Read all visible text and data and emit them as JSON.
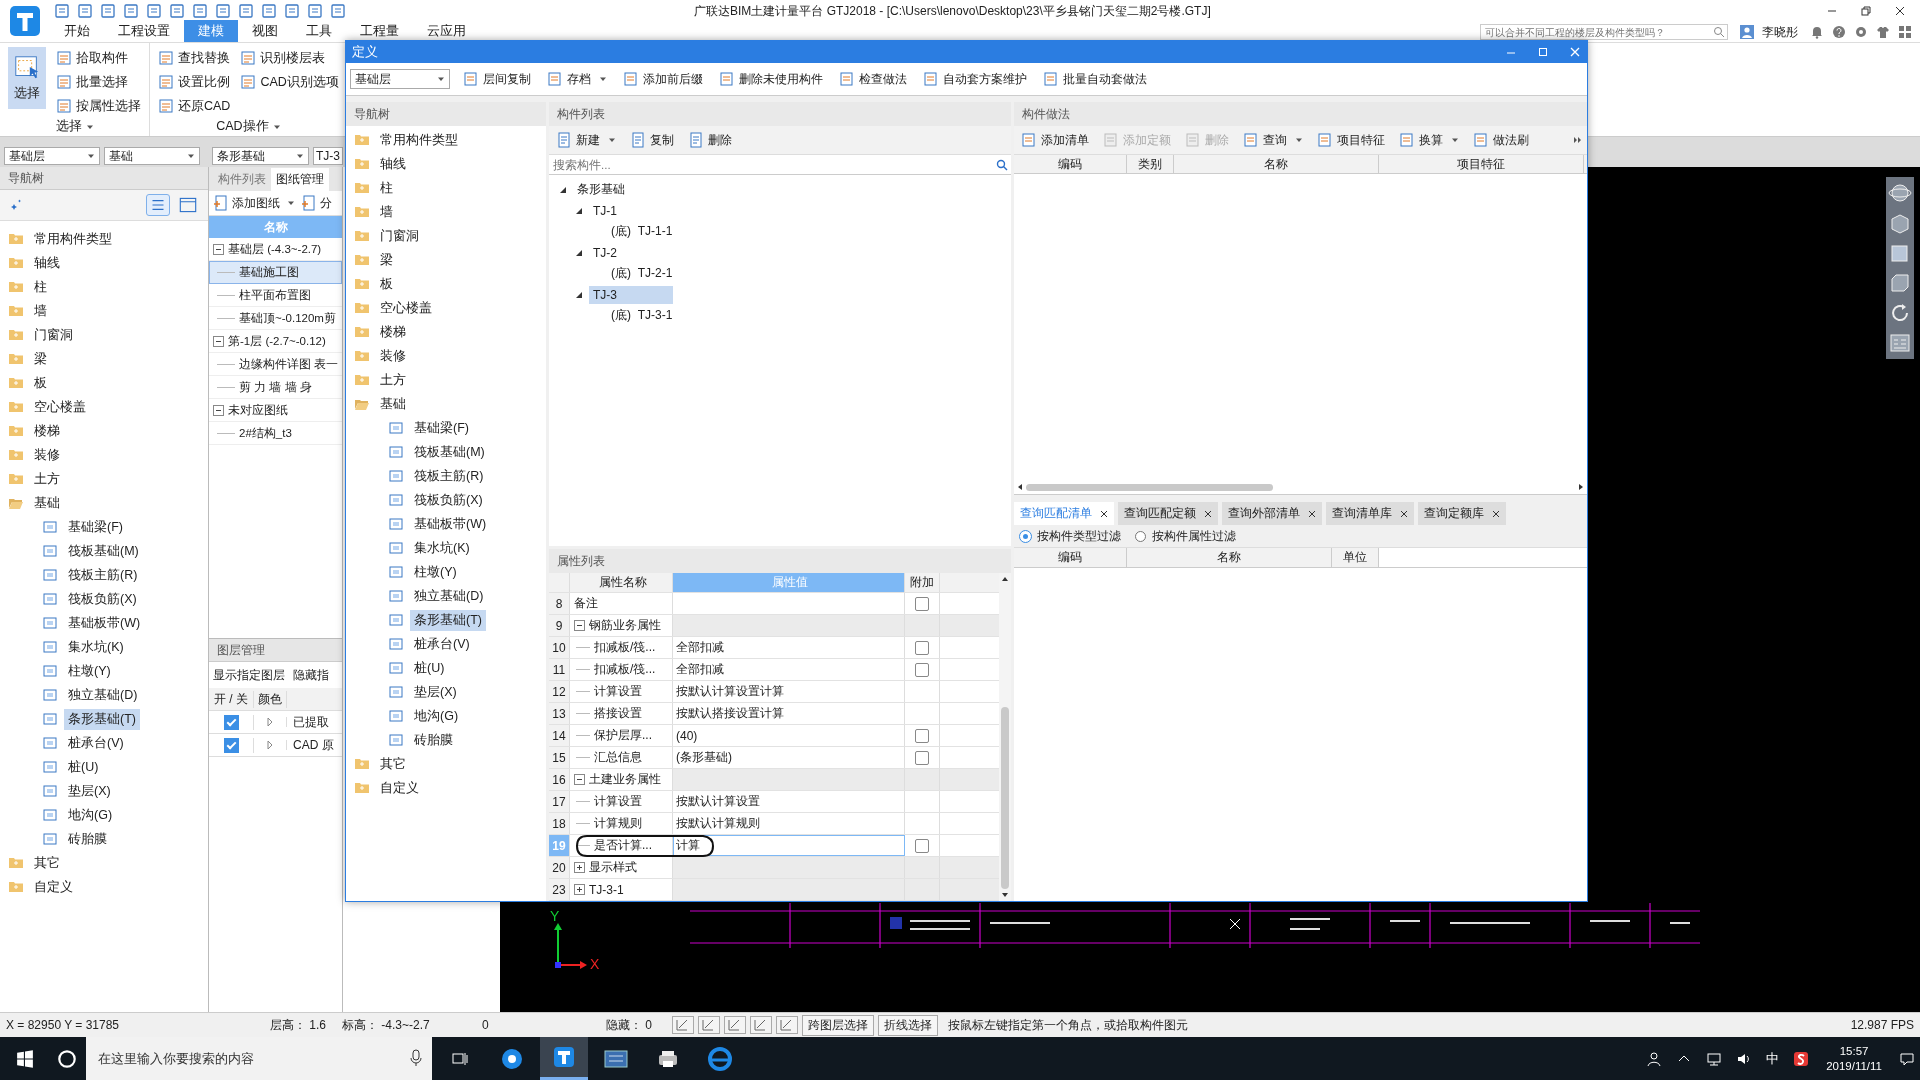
{
  "app": {
    "title": "广联达BIM土建计量平台 GTJ2018 - [C:\\Users\\lenovo\\Desktop\\23\\平乡县铭门天玺二期2号楼.GTJ]",
    "ribbon_tabs": [
      {
        "label": "开始",
        "selected": false
      },
      {
        "label": "工程设置",
        "selected": false
      },
      {
        "label": "建模",
        "selected": true
      },
      {
        "label": "视图",
        "selected": false
      },
      {
        "label": "工具",
        "selected": false
      },
      {
        "label": "工程量",
        "selected": false
      },
      {
        "label": "云应用",
        "selected": false
      }
    ],
    "help_search": {
      "placeholder": "可以合并不同工程的楼层及构件类型吗？"
    },
    "user": "李晓彤"
  },
  "ribbon": {
    "groups": [
      {
        "label": "选择",
        "big_button": "选择",
        "columns": [
          [
            "拾取构件",
            "批量选择",
            "按属性选择"
          ]
        ]
      },
      {
        "label": "CAD操作",
        "columns": [
          [
            "查找替换",
            "设置比例",
            "还原CAD"
          ],
          [
            "识别楼层表",
            "CAD识别选项"
          ]
        ]
      }
    ]
  },
  "selectors": [
    "基础层",
    "基础",
    "条形基础",
    "TJ-3"
  ],
  "nav_tree": {
    "title": "导航树",
    "items": [
      {
        "label": "常用构件类型",
        "expanded": false,
        "selected": false
      },
      {
        "label": "轴线",
        "expanded": false,
        "selected": false
      },
      {
        "label": "柱",
        "expanded": false,
        "selected": false
      },
      {
        "label": "墙",
        "expanded": false,
        "selected": false
      },
      {
        "label": "门窗洞",
        "expanded": false,
        "selected": false
      },
      {
        "label": "梁",
        "expanded": false,
        "selected": false
      },
      {
        "label": "板",
        "expanded": false,
        "selected": false
      },
      {
        "label": "空心楼盖",
        "expanded": false,
        "selected": false
      },
      {
        "label": "楼梯",
        "expanded": false,
        "selected": false
      },
      {
        "label": "装修",
        "expanded": false,
        "selected": false
      },
      {
        "label": "土方",
        "expanded": false,
        "selected": false
      },
      {
        "label": "基础",
        "expanded": true,
        "selected": false,
        "children": [
          {
            "label": "基础梁(F)",
            "selected": false
          },
          {
            "label": "筏板基础(M)",
            "selected": false
          },
          {
            "label": "筏板主筋(R)",
            "selected": false
          },
          {
            "label": "筏板负筋(X)",
            "selected": false
          },
          {
            "label": "基础板带(W)",
            "selected": false
          },
          {
            "label": "集水坑(K)",
            "selected": false
          },
          {
            "label": "柱墩(Y)",
            "selected": false
          },
          {
            "label": "独立基础(D)",
            "selected": false
          },
          {
            "label": "条形基础(T)",
            "selected": true
          },
          {
            "label": "桩承台(V)",
            "selected": false
          },
          {
            "label": "桩(U)",
            "selected": false
          },
          {
            "label": "垫层(X)",
            "selected": false
          },
          {
            "label": "地沟(G)",
            "selected": false
          },
          {
            "label": "砖胎膜",
            "selected": false
          }
        ]
      },
      {
        "label": "其它",
        "expanded": false,
        "selected": false
      },
      {
        "label": "自定义",
        "expanded": false,
        "selected": false
      }
    ]
  },
  "drawing_panel": {
    "tabs": [
      {
        "label": "构件列表",
        "selected": false
      },
      {
        "label": "图纸管理",
        "selected": true
      }
    ],
    "toolbar": [
      "添加图纸",
      "分"
    ],
    "column": "名称",
    "rows": [
      {
        "label": "基础层 (-4.3~-2.7)",
        "expanded": true,
        "selected": false,
        "children": [
          {
            "label": "基础施工图",
            "selected": true
          },
          {
            "label": "柱平面布置图",
            "selected": false
          },
          {
            "label": "基础顶~-0.120m剪",
            "selected": false
          }
        ]
      },
      {
        "label": "第-1层 (-2.7~-0.12)",
        "expanded": true,
        "selected": false,
        "children": [
          {
            "label": "边缘构件详图 表一",
            "selected": false
          },
          {
            "label": "剪 力 墙 墙 身",
            "selected": false
          }
        ]
      },
      {
        "label": "未对应图纸",
        "expanded": true,
        "selected": false,
        "children": [
          {
            "label": "2#结构_t3",
            "selected": false
          }
        ]
      }
    ]
  },
  "layers": {
    "title": "图层管理",
    "actions": [
      "显示指定图层",
      "隐藏指"
    ],
    "columns": [
      "开 / 关",
      "颜色"
    ],
    "rows": [
      {
        "on": true,
        "label": "已提取"
      },
      {
        "on": true,
        "label": "CAD 原"
      }
    ]
  },
  "dialog": {
    "title": "定义",
    "toolbar": {
      "floor": "基础层",
      "buttons": [
        {
          "label": "层间复制",
          "dropdown": false
        },
        {
          "label": "存档",
          "dropdown": true
        },
        {
          "label": "添加前后缀",
          "dropdown": false
        },
        {
          "label": "删除未使用构件",
          "dropdown": false
        },
        {
          "label": "检查做法",
          "dropdown": false
        },
        {
          "label": "自动套方案维护",
          "dropdown": false
        },
        {
          "label": "批量自动套做法",
          "dropdown": false
        }
      ]
    },
    "nav_tree": {
      "title": "导航树",
      "items": [
        {
          "label": "常用构件类型",
          "expanded": false,
          "selected": false
        },
        {
          "label": "轴线",
          "expanded": false,
          "selected": false
        },
        {
          "label": "柱",
          "expanded": false,
          "selected": false
        },
        {
          "label": "墙",
          "expanded": false,
          "selected": false
        },
        {
          "label": "门窗洞",
          "expanded": false,
          "selected": false
        },
        {
          "label": "梁",
          "expanded": false,
          "selected": false
        },
        {
          "label": "板",
          "expanded": false,
          "selected": false
        },
        {
          "label": "空心楼盖",
          "expanded": false,
          "selected": false
        },
        {
          "label": "楼梯",
          "expanded": false,
          "selected": false
        },
        {
          "label": "装修",
          "expanded": false,
          "selected": false
        },
        {
          "label": "土方",
          "expanded": false,
          "selected": false
        },
        {
          "label": "基础",
          "expanded": true,
          "selected": false,
          "children": [
            {
              "label": "基础梁(F)",
              "selected": false
            },
            {
              "label": "筏板基础(M)",
              "selected": false
            },
            {
              "label": "筏板主筋(R)",
              "selected": false
            },
            {
              "label": "筏板负筋(X)",
              "selected": false
            },
            {
              "label": "基础板带(W)",
              "selected": false
            },
            {
              "label": "集水坑(K)",
              "selected": false
            },
            {
              "label": "柱墩(Y)",
              "selected": false
            },
            {
              "label": "独立基础(D)",
              "selected": false
            },
            {
              "label": "条形基础(T)",
              "selected": true
            },
            {
              "label": "桩承台(V)",
              "selected": false
            },
            {
              "label": "桩(U)",
              "selected": false
            },
            {
              "label": "垫层(X)",
              "selected": false
            },
            {
              "label": "地沟(G)",
              "selected": false
            },
            {
              "label": "砖胎膜",
              "selected": false
            }
          ]
        },
        {
          "label": "其它",
          "expanded": false,
          "selected": false
        },
        {
          "label": "自定义",
          "expanded": false,
          "selected": false
        }
      ]
    },
    "component_list": {
      "title": "构件列表",
      "toolbar": [
        {
          "label": "新建",
          "dropdown": true
        },
        {
          "label": "复制",
          "dropdown": false
        },
        {
          "label": "删除",
          "dropdown": false
        }
      ],
      "search": {
        "placeholder": "搜索构件..."
      },
      "tree": [
        {
          "label": "条形基础",
          "expanded": true,
          "selected": false,
          "children": [
            {
              "label": "TJ-1",
              "expanded": true,
              "selected": false,
              "children": [
                {
                  "label": "(底)  TJ-1-1",
                  "selected": false
                }
              ]
            },
            {
              "label": "TJ-2",
              "expanded": true,
              "selected": false,
              "children": [
                {
                  "label": "(底)  TJ-2-1",
                  "selected": false
                }
              ]
            },
            {
              "label": "TJ-3",
              "expanded": true,
              "selected": true,
              "children": [
                {
                  "label": "(底)  TJ-3-1",
                  "selected": false
                }
              ]
            }
          ]
        }
      ]
    },
    "properties": {
      "title": "属性列表",
      "columns": [
        "属性名称",
        "属性值",
        "附加"
      ],
      "rows": [
        {
          "num": "8",
          "name": "备注",
          "selected": false,
          "checked": false
        },
        {
          "num": "9",
          "name": "钢筋业务属性",
          "expanded": true,
          "selected": false,
          "children": [
            {
              "num": "10",
              "name": "扣减板/筏...",
              "value": "全部扣减",
              "selected": false,
              "checked": false
            },
            {
              "num": "11",
              "name": "扣减板/筏...",
              "value": "全部扣减",
              "selected": false,
              "checked": false
            },
            {
              "num": "12",
              "name": "计算设置",
              "value": "按默认计算设置计算",
              "selected": false
            },
            {
              "num": "13",
              "name": "搭接设置",
              "value": "按默认搭接设置计算",
              "selected": false
            },
            {
              "num": "14",
              "name": "保护层厚...",
              "value": "(40)",
              "selected": false,
              "checked": false
            },
            {
              "num": "15",
              "name": "汇总信息",
              "value": "(条形基础)",
              "selected": false,
              "checked": false
            }
          ]
        },
        {
          "num": "16",
          "name": "土建业务属性",
          "expanded": true,
          "selected": false,
          "children": [
            {
              "num": "17",
              "name": "计算设置",
              "value": "按默认计算设置",
              "selected": false
            },
            {
              "num": "18",
              "name": "计算规则",
              "value": "按默认计算规则",
              "selected": false
            },
            {
              "num": "19",
              "name": "是否计算...",
              "value": "计算",
              "selected": true,
              "checked": false
            }
          ]
        },
        {
          "num": "20",
          "name": "显示样式",
          "expanded": false,
          "selected": false
        },
        {
          "num": "23",
          "name": "TJ-3-1",
          "expanded": false,
          "selected": false
        }
      ]
    },
    "methods": {
      "title": "构件做法",
      "toolbar": [
        {
          "label": "添加清单",
          "disabled": false,
          "dropdown": false
        },
        {
          "label": "添加定额",
          "disabled": true,
          "dropdown": false
        },
        {
          "label": "删除",
          "disabled": true,
          "dropdown": false
        },
        {
          "label": "查询",
          "disabled": false,
          "dropdown": true
        },
        {
          "label": "项目特征",
          "disabled": false,
          "dropdown": false
        },
        {
          "label": "换算",
          "disabled": false,
          "dropdown": true
        },
        {
          "label": "做法刷",
          "disabled": false,
          "dropdown": false
        }
      ],
      "columns": [
        "编码",
        "类别",
        "名称",
        "项目特征"
      ]
    },
    "query": {
      "tabs": [
        {
          "label": "查询匹配清单",
          "selected": true
        },
        {
          "label": "查询匹配定额",
          "selected": false
        },
        {
          "label": "查询外部清单",
          "selected": false
        },
        {
          "label": "查询清单库",
          "selected": false
        },
        {
          "label": "查询定额库",
          "selected": false
        }
      ],
      "filters": [
        {
          "label": "按构件类型过滤",
          "selected": true
        },
        {
          "label": "按构件属性过滤",
          "selected": false
        }
      ],
      "columns": [
        "编码",
        "名称",
        "单位"
      ]
    }
  },
  "canvas": {
    "axis": {
      "y": "Y",
      "x": "X"
    }
  },
  "status_bar": {
    "coords": "X = 82950 Y = 31785",
    "floor_height": "层高： 1.6",
    "elevation": "标高： -4.3~-2.7",
    "count": "0",
    "hidden": "隐藏： 0",
    "buttons": [
      "跨图层选择",
      "折线选择"
    ],
    "hint": "按鼠标左键指定第一个角点，或拾取构件图元",
    "fps": "12.987 FPS"
  },
  "taskbar": {
    "search": {
      "placeholder": "在这里输入你要搜索的内容"
    },
    "apps": [
      {
        "selected": false
      },
      {
        "selected": true
      },
      {
        "selected": false
      },
      {
        "selected": false
      },
      {
        "selected": false
      }
    ],
    "ime": "中",
    "time": "15:57",
    "date": "2019/11/11"
  }
}
